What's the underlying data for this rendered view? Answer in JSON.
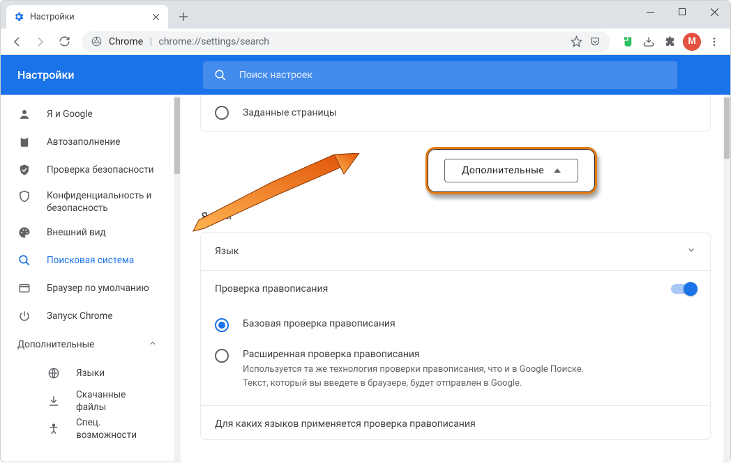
{
  "window": {
    "tab_title": "Настройки"
  },
  "toolbar": {
    "url_scheme": "Chrome",
    "url_path": "chrome://settings/search",
    "avatar_letter": "M"
  },
  "header": {
    "title": "Настройки",
    "search_placeholder": "Поиск настроек"
  },
  "sidebar": {
    "items": [
      {
        "label": "Я и Google"
      },
      {
        "label": "Автозаполнение"
      },
      {
        "label": "Проверка безопасности"
      },
      {
        "label": "Конфиденциальность и безопасность"
      },
      {
        "label": "Внешний вид"
      },
      {
        "label": "Поисковая система"
      },
      {
        "label": "Браузер по умолчанию"
      },
      {
        "label": "Запуск Chrome"
      }
    ],
    "section_label": "Дополнительные",
    "sub_items": [
      {
        "label": "Языки"
      },
      {
        "label": "Скачанные файлы"
      },
      {
        "label": "Спец. возможности"
      }
    ]
  },
  "content": {
    "startup_option": "Заданные страницы",
    "advanced_button": "Дополнительные",
    "languages_section": "Языки",
    "language_row": "Язык",
    "spellcheck_label": "Проверка правописания",
    "basic_label": "Базовая проверка правописания",
    "enhanced_label": "Расширенная проверка правописания",
    "enhanced_desc": "Используется та же технология проверки правописания, что и в Google Поиске. Текст, который вы введете в браузере, будет отправлен в Google.",
    "apply_label": "Для каких языков применяется проверка правописания"
  }
}
